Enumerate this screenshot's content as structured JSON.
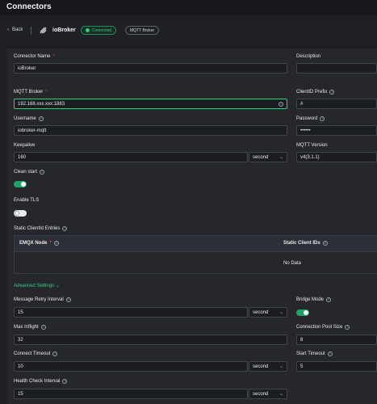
{
  "header": {
    "title": "Connectors"
  },
  "subheader": {
    "back_label": "Back",
    "connector_name": "ioBroker",
    "status_badge": "Connected",
    "type_badge": "MQTT Broker"
  },
  "form": {
    "connector_name": {
      "label": "Connector Name",
      "required": "*",
      "value": "ioBroker"
    },
    "description": {
      "label": "Description",
      "value": ""
    },
    "mqtt_broker": {
      "label": "MQTT Broker",
      "required": "*",
      "value": "192.168.xxx.xxx:1883"
    },
    "clientid_prefix": {
      "label": "ClientID Prefix",
      "value": "#"
    },
    "username": {
      "label": "Username",
      "value": "iobroker-mqtt"
    },
    "password": {
      "label": "Password",
      "value": "••••••"
    },
    "keepalive": {
      "label": "Keepalive",
      "value": "160",
      "unit": "second"
    },
    "mqtt_version": {
      "label": "MQTT Version",
      "value": "v4(3.1.1)"
    },
    "clean_start": {
      "label": "Clean start",
      "on": true
    },
    "enable_tls": {
      "label": "Enable TLS",
      "on": false
    },
    "static_clientid": {
      "label": "Static ClientId Entries",
      "columns": [
        "EMQX Node",
        "Static Client IDs"
      ],
      "empty_text": "No Data"
    },
    "advanced_toggle": "Advanced Settings",
    "message_retry_interval": {
      "label": "Message Retry Interval",
      "value": "15",
      "unit": "second"
    },
    "bridge_mode": {
      "label": "Bridge Mode",
      "on": true
    },
    "max_inflight": {
      "label": "Max Inflight",
      "value": "32"
    },
    "connection_pool_size": {
      "label": "Connection Pool Size",
      "value": "8"
    },
    "connect_timeout": {
      "label": "Connect Timeout",
      "value": "10",
      "unit": "second"
    },
    "start_timeout": {
      "label": "Start Timeout",
      "value": "5"
    },
    "health_check_interval": {
      "label": "Health Check Interval",
      "value": "15",
      "unit": "second"
    }
  },
  "colors": {
    "accent": "#2bd17e",
    "required": "#e5484d",
    "background": "#1e2026"
  }
}
